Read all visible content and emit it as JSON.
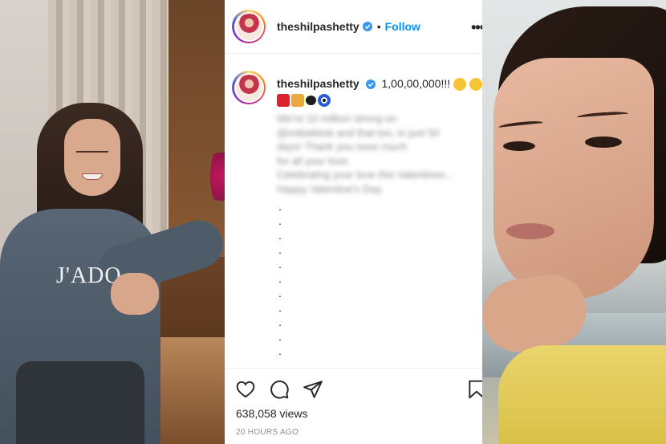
{
  "post": {
    "username": "theshilpashetty",
    "separator": "•",
    "follow_label": "Follow",
    "more_label": "•••",
    "caption": {
      "username": "theshilpashetty",
      "headline": "1,00,00,000!!!",
      "blurred_lines": [
        "We're 10 million strong  on",
        "@indiatiktok and that too, in just 50",
        "days!   Thank you sooo much",
        "for all your love.",
        "Celebrating your love this Valentines...",
        "Happy Valentine's Day."
      ],
      "dots": [
        ".",
        ".",
        ".",
        ".",
        ".",
        ".",
        ".",
        ".",
        ".",
        ".",
        ".",
        "."
      ]
    },
    "views": "638,058 views",
    "time": "20 HOURS AGO"
  },
  "icons": [
    "verified-badge-icon",
    "heart-icon",
    "comment-icon",
    "share-icon",
    "bookmark-icon",
    "more-icon"
  ],
  "colors": {
    "follow_blue": "#0095f6",
    "verified_blue": "#3897f0",
    "text": "#262626",
    "muted": "#8e8e8e"
  }
}
